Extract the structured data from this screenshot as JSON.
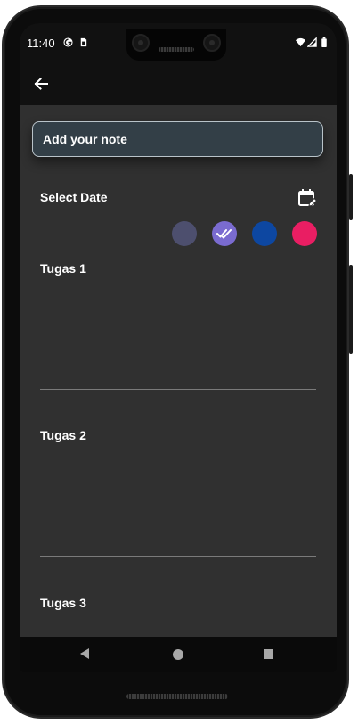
{
  "status_bar": {
    "time": "11:40",
    "icons": [
      "google-play-protect-icon",
      "sim-card-icon",
      "wifi-icon",
      "signal-icon",
      "battery-icon"
    ]
  },
  "app_bar": {
    "back_icon": "arrow-back-icon"
  },
  "note_input": {
    "placeholder": "Add your note"
  },
  "date_row": {
    "label": "Select Date",
    "icon": "calendar-edit-icon"
  },
  "colors": [
    {
      "name": "slate",
      "hex": "#4d4f6e",
      "selected": false
    },
    {
      "name": "purple",
      "hex": "#7a6bd0",
      "selected": true
    },
    {
      "name": "blue",
      "hex": "#0d47a1",
      "selected": false
    },
    {
      "name": "pink",
      "hex": "#e91e63",
      "selected": false
    }
  ],
  "tasks": [
    {
      "title": "Tugas 1"
    },
    {
      "title": "Tugas 2"
    },
    {
      "title": "Tugas 3"
    }
  ],
  "nav_bar": {
    "back": "nav-back-icon",
    "home": "nav-home-icon",
    "recents": "nav-recents-icon"
  }
}
